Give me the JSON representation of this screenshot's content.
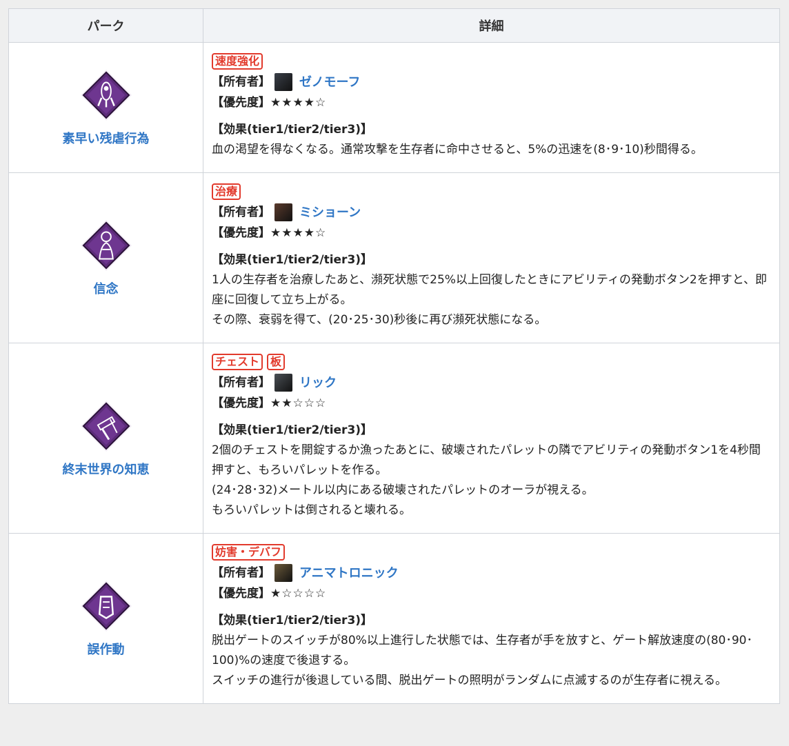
{
  "table": {
    "header_perk": "パーク",
    "header_detail": "詳細"
  },
  "labels": {
    "owner": "【所有者】",
    "priority": "【優先度】",
    "effect": "【効果(tier1/tier2/tier3)】"
  },
  "perks": [
    {
      "name": "素早い残虐行為",
      "tags": [
        "速度強化"
      ],
      "owner": "ゼノモーフ",
      "priority": "★★★★☆",
      "effect": [
        "血の渇望を得なくなる。通常攻撃を生存者に命中させると、5%の迅速を(8･9･10)秒間得る。"
      ],
      "icon": "xenomorph-perk-icon",
      "avatar_color": "#3a3f48"
    },
    {
      "name": "信念",
      "tags": [
        "治療"
      ],
      "owner": "ミショーン",
      "priority": "★★★★☆",
      "effect": [
        "1人の生存者を治療したあと、瀕死状態で25%以上回復したときにアビリティの発動ボタン2を押すと、即座に回復して立ち上がる。",
        "その際、衰弱を得て、(20･25･30)秒後に再び瀕死状態になる。"
      ],
      "icon": "conviction-perk-icon",
      "avatar_color": "#5a3a2c"
    },
    {
      "name": "終末世界の知恵",
      "tags": [
        "チェスト",
        "板"
      ],
      "owner": "リック",
      "priority": "★★☆☆☆",
      "effect": [
        "2個のチェストを開錠するか漁ったあとに、破壊されたパレットの隣でアビリティの発動ボタン1を4秒間押すと、もろいパレットを作る。",
        "(24･28･32)メートル以内にある破壊されたパレットのオーラが視える。",
        "もろいパレットは倒されると壊れる。"
      ],
      "icon": "apocalyptic-ingenuity-perk-icon",
      "avatar_color": "#4a4f55"
    },
    {
      "name": "誤作動",
      "tags": [
        "妨害・デバフ"
      ],
      "owner": "アニマトロニック",
      "priority": "★☆☆☆☆",
      "effect": [
        "脱出ゲートのスイッチが80%以上進行した状態では、生存者が手を放すと、ゲート解放速度の(80･90･100)%の速度で後退する。",
        "スイッチの進行が後退している間、脱出ゲートの照明がランダムに点滅するのが生存者に視える。"
      ],
      "icon": "malfunction-perk-icon",
      "avatar_color": "#6b5a3a"
    }
  ],
  "colors": {
    "link": "#2f76c5",
    "tag": "#e23a2c",
    "icon_bg": "#5b2b78"
  }
}
